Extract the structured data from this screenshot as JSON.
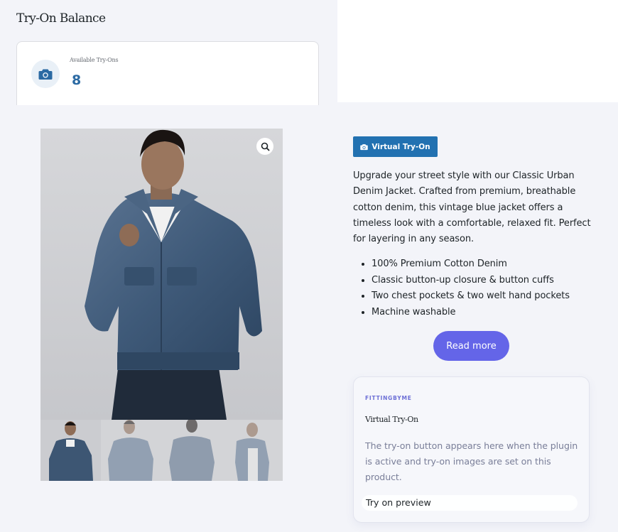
{
  "balance": {
    "title": "Try-On Balance",
    "label": "Available Try-Ons",
    "value": "8",
    "icon": "camera-icon"
  },
  "product": {
    "tryon_button_label": "Virtual Try-On",
    "description": "Upgrade your street style with our Classic Urban Denim Jacket. Crafted from premium, breathable cotton denim, this vintage blue jacket offers a timeless look with a comfortable, relaxed fit. Perfect for layering in any season.",
    "features": [
      "100% Premium Cotton Denim",
      "Classic button-up closure & button cuffs",
      "Two chest pockets & two welt hand pockets",
      "Machine washable"
    ],
    "read_more_label": "Read more"
  },
  "preview_card": {
    "brand": "FITTINGBYME",
    "title": "Virtual Try-On",
    "text": "The try-on button appears here when the plugin is active and try-on images are set on this product.",
    "preview_label": "Try on preview"
  },
  "colors": {
    "accent": "#2271b1",
    "read_more": "#6465e8",
    "brand": "#6c6fd6",
    "balance_value": "#2b6aa3"
  }
}
